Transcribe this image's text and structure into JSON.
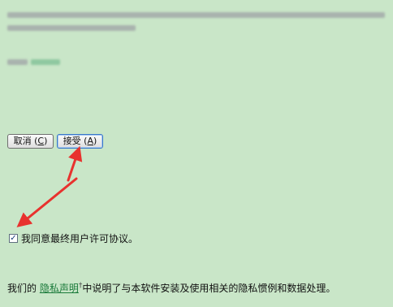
{
  "buttons": {
    "cancel": {
      "label": "取消 (",
      "key": "C",
      "tail": ")"
    },
    "accept": {
      "label": "接受 (",
      "key": "A",
      "tail": ")"
    }
  },
  "agreement": {
    "checked": true,
    "check_glyph": "☑",
    "label": "我同意最终用户许可协议。"
  },
  "privacy": {
    "prefix": "我们的 ",
    "link": "隐私声明",
    "marker": "†",
    "suffix": "中说明了与本软件安装及使用相关的隐私惯例和数据处理。"
  },
  "colors": {
    "background": "#c9e6c8",
    "arrow": "#e8322e",
    "link": "#1a7a3a"
  }
}
